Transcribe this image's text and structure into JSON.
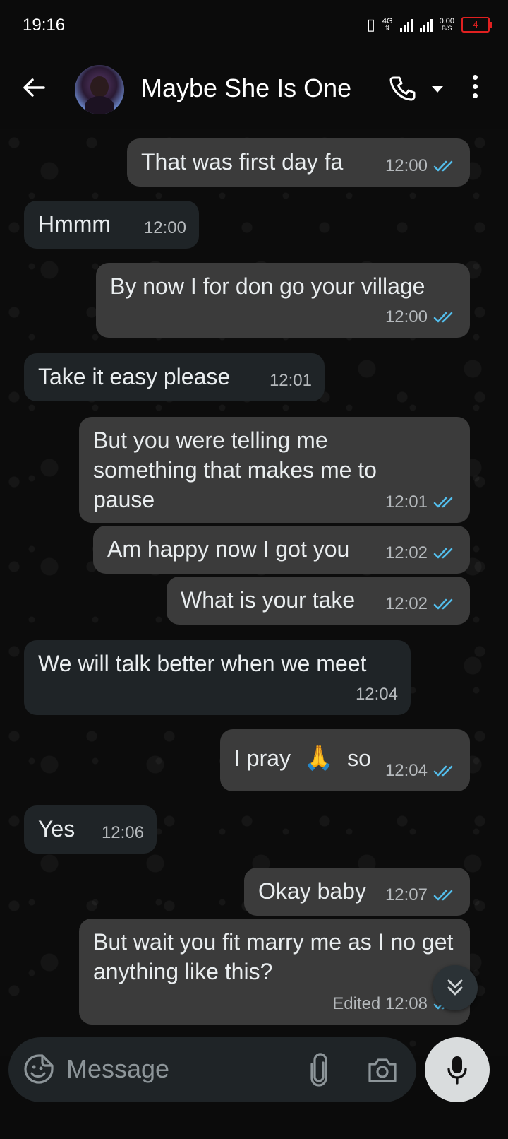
{
  "status_bar": {
    "time": "19:16",
    "network": "4G",
    "data_rate_value": "0.00",
    "data_rate_unit": "B/S",
    "battery": "4"
  },
  "header": {
    "contact_name": "Maybe She Is One"
  },
  "messages": [
    {
      "dir": "out",
      "text": "That was  first day fa",
      "time": "12:00",
      "ticks": true
    },
    {
      "dir": "in",
      "text": "Hmmm",
      "time": "12:00"
    },
    {
      "dir": "out",
      "text": "By now I for don go your village",
      "time": "12:00",
      "ticks": true
    },
    {
      "dir": "in",
      "text": "Take it easy please",
      "time": "12:01"
    },
    {
      "dir": "out",
      "text": "But you were telling me something that makes me to pause",
      "time": "12:01",
      "ticks": true
    },
    {
      "dir": "out",
      "text": "Am happy now I got you",
      "time": "12:02",
      "ticks": true
    },
    {
      "dir": "out",
      "text": "What is your take",
      "time": "12:02",
      "ticks": true
    },
    {
      "dir": "in",
      "text": "We will talk better when we meet",
      "time": "12:04"
    },
    {
      "dir": "out",
      "text_before": "I pray",
      "emoji": "🙏",
      "text_after": "so",
      "time": "12:04",
      "ticks": true
    },
    {
      "dir": "in",
      "text": "Yes",
      "time": "12:06"
    },
    {
      "dir": "out",
      "text": "Okay baby",
      "time": "12:07",
      "ticks": true
    },
    {
      "dir": "out",
      "text": "But wait you fit marry me as I no get anything like this?",
      "time": "Edited 12:08",
      "ticks": true
    }
  ],
  "composer": {
    "placeholder": "Message"
  },
  "colors": {
    "outgoing_bubble": "#3b3b3b",
    "incoming_bubble": "#1f2427",
    "read_ticks": "#53bdeb"
  }
}
